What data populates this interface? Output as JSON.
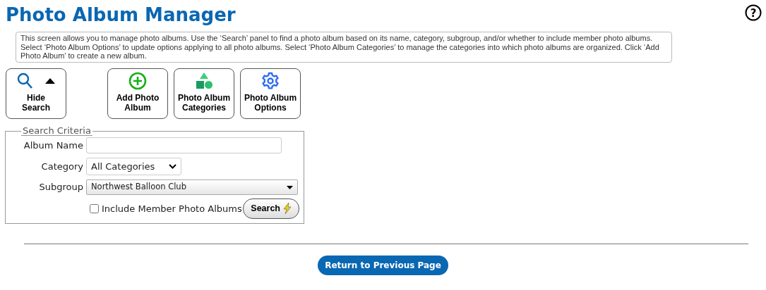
{
  "title": "Photo Album Manager",
  "help": {
    "label": "?"
  },
  "description": "This screen allows you to manage photo albums. Use the ‘Search’ panel to find a photo album based on its name, category, subgroup, and/or whether to include member photo albums. Select ‘Photo Album Options’ to update options applying to all photo albums. Select ‘Photo Album Categories’ to manage the categories into which photo albums are organized. Click ‘Add Photo Album’ to create a new album.",
  "toolbar": [
    {
      "kind": "search-toggle",
      "label": "Hide Search",
      "expanded": true
    },
    {
      "kind": "add",
      "label": "Add Photo Album"
    },
    {
      "kind": "shapes",
      "label": "Photo Album Categories"
    },
    {
      "kind": "gear",
      "label": "Photo Album Options"
    }
  ],
  "search": {
    "legend": "Search Criteria",
    "album_name": {
      "label": "Album Name"
    },
    "category": {
      "label": "Category",
      "value": "All Categories"
    },
    "subgroup": {
      "label": "Subgroup",
      "value": "Northwest Balloon Club"
    },
    "include_member": {
      "label": "Include Member Photo Albums",
      "checked": false
    },
    "button": "Search"
  },
  "return_button": "Return to Previous Page"
}
